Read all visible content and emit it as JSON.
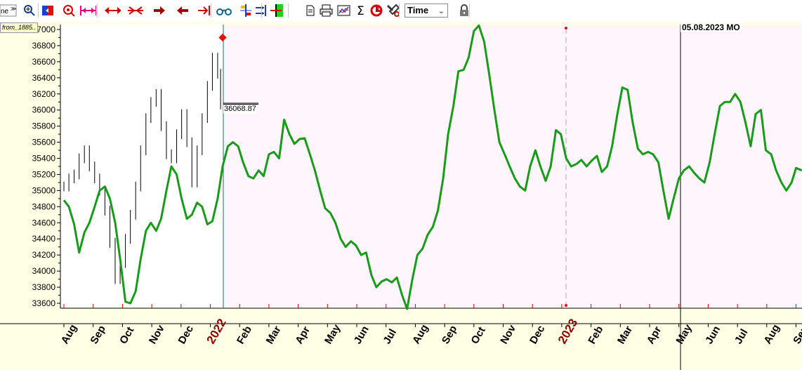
{
  "toolbar": {
    "items": [
      {
        "name": "zoom-in-icon",
        "glyph": "🔍"
      },
      {
        "name": "color-swatch-icon",
        "glyph": ""
      },
      {
        "name": "target-zoom-icon",
        "glyph": ""
      },
      {
        "name": "fit-width-icon",
        "glyph": ""
      },
      {
        "name": "expand-horizontal-icon",
        "glyph": ""
      },
      {
        "name": "compress-horizontal-icon",
        "glyph": ""
      },
      {
        "name": "scroll-right-icon",
        "glyph": ""
      },
      {
        "name": "scroll-left-icon",
        "glyph": ""
      },
      {
        "name": "goto-end-icon",
        "glyph": ""
      },
      {
        "name": "glasses-icon",
        "glyph": ""
      },
      {
        "name": "split-icon",
        "glyph": ""
      },
      {
        "name": "merge-icon",
        "glyph": ""
      },
      {
        "name": "cursor-marker-icon",
        "glyph": ""
      },
      {
        "name": "document-icon",
        "glyph": ""
      },
      {
        "name": "print-icon",
        "glyph": ""
      },
      {
        "name": "chart-icon",
        "glyph": ""
      },
      {
        "name": "sigma-icon",
        "glyph": "Σ"
      },
      {
        "name": "cycle-icon",
        "glyph": ""
      },
      {
        "name": "tools-icon",
        "glyph": ""
      },
      {
        "name": "lock-icon",
        "glyph": ""
      }
    ],
    "time_select_value": "Time"
  },
  "overlay_label": "from_1885..",
  "cursor_date_label": "05.08.2023 MO",
  "last_price_label": "36068.87",
  "colors": {
    "background_history": "#ffffff",
    "background_forecast": "#fff5fc",
    "page": "#ffffe6",
    "forecast_line": "#1a9a1a",
    "price_bars": "#000000",
    "year_label": "#8b0000"
  },
  "chart_data": {
    "type": "line",
    "ylim": [
      33500,
      37000
    ],
    "y_ticks": [
      33600,
      33800,
      34000,
      34200,
      34400,
      34600,
      34800,
      35000,
      35200,
      35400,
      35600,
      35800,
      36000,
      36200,
      36400,
      36600,
      36800,
      37000
    ],
    "y_tick_labels": [
      "33600",
      "33800",
      "34000",
      "34200",
      "34400",
      "34600",
      "34800",
      "35000",
      "35200",
      "35400",
      "35600",
      "35800",
      "36000",
      "36200",
      "36400",
      "36600",
      "36800",
      "37000"
    ],
    "x_tick_labels": [
      {
        "label": "Aug",
        "year": false
      },
      {
        "label": "Sep",
        "year": false
      },
      {
        "label": "Oct",
        "year": false
      },
      {
        "label": "Nov",
        "year": false
      },
      {
        "label": "Dec",
        "year": false
      },
      {
        "label": "2022",
        "year": true
      },
      {
        "label": "Feb",
        "year": false
      },
      {
        "label": "Mar",
        "year": false
      },
      {
        "label": "Apr",
        "year": false
      },
      {
        "label": "May",
        "year": false
      },
      {
        "label": "Jun",
        "year": false
      },
      {
        "label": "Jul",
        "year": false
      },
      {
        "label": "Aug",
        "year": false
      },
      {
        "label": "Sep",
        "year": false
      },
      {
        "label": "Oct",
        "year": false
      },
      {
        "label": "Nov",
        "year": false
      },
      {
        "label": "Dec",
        "year": false
      },
      {
        "label": "2023",
        "year": true
      },
      {
        "label": "Feb",
        "year": false
      },
      {
        "label": "Mar",
        "year": false
      },
      {
        "label": "Apr",
        "year": false
      },
      {
        "label": "May",
        "year": false
      },
      {
        "label": "Jun",
        "year": false
      },
      {
        "label": "Jul",
        "year": false
      },
      {
        "label": "Aug",
        "year": false
      },
      {
        "label": "Sep",
        "year": false
      }
    ],
    "series": [
      {
        "kind": "price",
        "x_months": [
          0.0,
          0.17,
          0.35,
          0.52,
          0.7,
          0.87,
          1.05,
          1.22,
          1.4,
          1.57,
          1.75,
          1.92,
          2.1,
          2.27,
          2.45,
          2.62,
          2.8,
          2.97,
          3.15,
          3.32,
          3.5,
          3.67,
          3.85,
          4.02,
          4.2,
          4.37,
          4.55,
          4.72,
          4.9,
          5.07,
          5.25,
          5.35
        ],
        "values": [
          35050,
          35150,
          35200,
          35400,
          35500,
          35300,
          35150,
          35000,
          34750,
          34350,
          33900,
          34100,
          34400,
          34700,
          35050,
          35500,
          35900,
          36100,
          36200,
          35800,
          35450,
          35400,
          35700,
          35950,
          35600,
          35100,
          35500,
          35900,
          36300,
          36650,
          36450,
          36068.87
        ]
      },
      {
        "kind": "forecast",
        "x_months": [
          0.0,
          0.17,
          0.35,
          0.52,
          0.7,
          0.87,
          1.05,
          1.22,
          1.4,
          1.57,
          1.75,
          1.92,
          2.1,
          2.27,
          2.45,
          2.62,
          2.8,
          2.97,
          3.15,
          3.32,
          3.5,
          3.67,
          3.85,
          4.02,
          4.2,
          4.37,
          4.55,
          4.72,
          4.9,
          5.07,
          5.25,
          5.42,
          5.6,
          5.77,
          5.95,
          6.12,
          6.3,
          6.47,
          6.65,
          6.82,
          7.0,
          7.17,
          7.35,
          7.52,
          7.7,
          7.87,
          8.05,
          8.22,
          8.4,
          8.57,
          8.75,
          8.92,
          9.1,
          9.27,
          9.45,
          9.62,
          9.8,
          9.97,
          10.15,
          10.32,
          10.5,
          10.67,
          10.85,
          11.02,
          11.2,
          11.37,
          11.55,
          11.72,
          11.9,
          12.07,
          12.25,
          12.42,
          12.6,
          12.77,
          12.95,
          13.12,
          13.3,
          13.47,
          13.65,
          13.82,
          14.0,
          14.17,
          14.35,
          14.52,
          14.7,
          14.87,
          15.05,
          15.22,
          15.4,
          15.57,
          15.75,
          15.92,
          16.1,
          16.27,
          16.45,
          16.62,
          16.8,
          16.97,
          17.15,
          17.32,
          17.5,
          17.67,
          17.85,
          18.02,
          18.2,
          18.37,
          18.55,
          18.72,
          18.9,
          19.07,
          19.25,
          19.42,
          19.6,
          19.77,
          19.95,
          20.12,
          20.3,
          20.47,
          20.65,
          20.82,
          21.0,
          21.17,
          21.35,
          21.52,
          21.7,
          21.87,
          22.05,
          22.22,
          22.4,
          22.57,
          22.75,
          22.92,
          23.1,
          23.27,
          23.45,
          23.62,
          23.8,
          23.97,
          24.15,
          24.32,
          24.5,
          24.67,
          24.85,
          25.0,
          25.2
        ],
        "values": [
          34880,
          34800,
          34580,
          34230,
          34480,
          34600,
          34800,
          35000,
          35050,
          34900,
          34600,
          34150,
          33620,
          33600,
          33750,
          34150,
          34500,
          34600,
          34500,
          34650,
          35000,
          35300,
          35200,
          34900,
          34650,
          34700,
          34850,
          34800,
          34580,
          34620,
          34900,
          35300,
          35550,
          35600,
          35550,
          35350,
          35180,
          35150,
          35250,
          35180,
          35450,
          35480,
          35400,
          35880,
          35700,
          35580,
          35640,
          35650,
          35450,
          35250,
          35000,
          34780,
          34720,
          34600,
          34400,
          34300,
          34370,
          34320,
          34200,
          34230,
          33950,
          33800,
          33870,
          33900,
          33860,
          33920,
          33700,
          33530,
          33900,
          34200,
          34280,
          34450,
          34550,
          34750,
          35150,
          35700,
          36050,
          36480,
          36500,
          36650,
          36980,
          37050,
          36850,
          36450,
          36000,
          35600,
          35450,
          35300,
          35150,
          35050,
          35000,
          35300,
          35500,
          35300,
          35120,
          35300,
          35750,
          35700,
          35400,
          35300,
          35330,
          35380,
          35300,
          35370,
          35430,
          35230,
          35300,
          35550,
          35950,
          36280,
          36250,
          35850,
          35520,
          35450,
          35480,
          35450,
          35350,
          35000,
          34650,
          34900,
          35150,
          35250,
          35300,
          35220,
          35150,
          35100,
          35350,
          35700,
          36050,
          36100,
          36100,
          36200,
          36100,
          35850,
          35550,
          35950,
          36000,
          35500,
          35450,
          35250,
          35100,
          35000,
          35100,
          35280,
          35250,
          35100,
          34600,
          34200,
          34050,
          34200,
          34900,
          35000,
          35150,
          35600,
          35750,
          35650
        ]
      }
    ],
    "grid": false
  }
}
